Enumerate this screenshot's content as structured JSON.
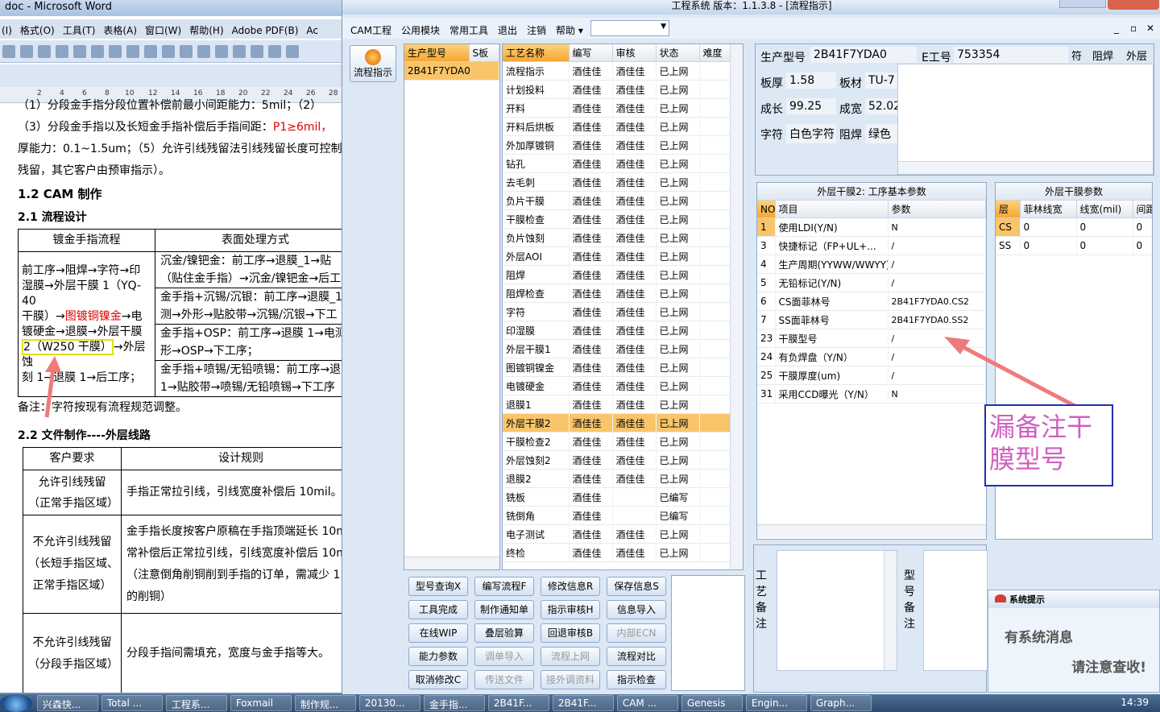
{
  "word": {
    "title": "doc - Microsoft Word",
    "menu": [
      "(I)",
      "格式(O)",
      "工具(T)",
      "表格(A)",
      "窗口(W)",
      "帮助(H)",
      "Adobe PDF(B)",
      "Ac"
    ],
    "ruler": [
      "2",
      "4",
      "6",
      "8",
      "10",
      "12",
      "14",
      "16",
      "18",
      "20",
      "22",
      "24",
      "26",
      "28"
    ],
    "lines": {
      "l1": "（1）分段金手指分段位置补偿前最小间距能力：5mil；（2）",
      "l2a": "（3）分段金手指以及长短金手指补偿后手指间距：",
      "l2b": "P1≥6mil，",
      "l3": "厚能力：0.1~1.5um；（5）允许引线残留法引线残留长度可控制在",
      "l4": "残留，其它客户由预审指示）。",
      "h12": "1.2 CAM 制作",
      "h21": "2.1 流程设计",
      "note": "备注：字符按现有流程规范调整。",
      "h22": "2.2 文件制作----外层线路"
    },
    "table1": {
      "head1": "镀金手指流程",
      "head2": "表面处理方式",
      "left": [
        "前工序→阻焊→字符→印",
        "湿膜→外层干膜 1（YQ-40",
        "干膜）→",
        "图镀铜镍金",
        "→电",
        "镀硬金→退膜→外层干膜",
        "2（W250 干膜）",
        "→外层蚀",
        "刻 1→退膜 1→后工序；"
      ],
      "r1": [
        "沉金/镍钯金：前工序→退膜_1→贴",
        "（贴住金手指）→沉金/镍钯金→后工"
      ],
      "r2": [
        "金手指+沉锡/沉银：前工序→退膜_1",
        "测→外形→贴胶带→沉锡/沉银→下工"
      ],
      "r3": [
        "金手指+OSP：前工序→退膜 1→电测",
        "形→OSP→下工序；"
      ],
      "r4": [
        "金手指+喷锡/无铅喷锡：前工序→退",
        "1→贴胶带→喷锡/无铅喷锡→下工序"
      ]
    },
    "table2": {
      "head1": "客户要求",
      "head2": "设计规则",
      "rows": [
        {
          "req": [
            "允许引线残留",
            "（正常手指区域）"
          ],
          "rule": [
            "手指正常拉引线，引线宽度补偿后 10mil。"
          ]
        },
        {
          "req": [
            "不允许引线残留",
            "（长短手指区域、",
            "正常手指区域）"
          ],
          "rule": [
            "金手指长度按客户原稿在手指顶端延长 10m",
            "常补偿后正常拉引线，引线宽度补偿后 10m",
            "（注意倒角削铜削到手指的订单，需减少 1",
            "的削铜）"
          ]
        },
        {
          "req": [
            "不允许引线残留",
            "（分段手指区域）"
          ],
          "rule": [
            "分段手指间需填充，宽度与金手指等大。"
          ]
        }
      ]
    }
  },
  "cam": {
    "title": "工程系统   版本：1.1.3.8 - [流程指示]",
    "menu": [
      "CAM工程",
      "公用模块",
      "常用工具",
      "退出",
      "注销",
      "帮助 ▾"
    ],
    "left_button": "流程指示",
    "model_list": {
      "col1": "生产型号",
      "col2": "S板",
      "row": "2B41F7YDA0"
    },
    "process": {
      "headers": [
        "工艺名称",
        "编写",
        "审核",
        "状态",
        "难度"
      ],
      "rows": [
        [
          "流程指示",
          "酒佳佳",
          "酒佳佳",
          "已上网"
        ],
        [
          "计划投料",
          "酒佳佳",
          "酒佳佳",
          "已上网"
        ],
        [
          "开料",
          "酒佳佳",
          "酒佳佳",
          "已上网"
        ],
        [
          "开料后烘板",
          "酒佳佳",
          "酒佳佳",
          "已上网"
        ],
        [
          "外加厚镀铜",
          "酒佳佳",
          "酒佳佳",
          "已上网"
        ],
        [
          "钻孔",
          "酒佳佳",
          "酒佳佳",
          "已上网"
        ],
        [
          "去毛刺",
          "酒佳佳",
          "酒佳佳",
          "已上网"
        ],
        [
          "负片干膜",
          "酒佳佳",
          "酒佳佳",
          "已上网"
        ],
        [
          "干膜检查",
          "酒佳佳",
          "酒佳佳",
          "已上网"
        ],
        [
          "负片蚀刻",
          "酒佳佳",
          "酒佳佳",
          "已上网"
        ],
        [
          "外层AOI",
          "酒佳佳",
          "酒佳佳",
          "已上网"
        ],
        [
          "阻焊",
          "酒佳佳",
          "酒佳佳",
          "已上网"
        ],
        [
          "阻焊检查",
          "酒佳佳",
          "酒佳佳",
          "已上网"
        ],
        [
          "字符",
          "酒佳佳",
          "酒佳佳",
          "已上网"
        ],
        [
          "印湿膜",
          "酒佳佳",
          "酒佳佳",
          "已上网"
        ],
        [
          "外层干膜1",
          "酒佳佳",
          "酒佳佳",
          "已上网"
        ],
        [
          "图镀铜镍金",
          "酒佳佳",
          "酒佳佳",
          "已上网"
        ],
        [
          "电镀硬金",
          "酒佳佳",
          "酒佳佳",
          "已上网"
        ],
        [
          "退膜1",
          "酒佳佳",
          "酒佳佳",
          "已上网"
        ],
        [
          "外层干膜2",
          "酒佳佳",
          "酒佳佳",
          "已上网"
        ],
        [
          "干膜检查2",
          "酒佳佳",
          "酒佳佳",
          "已上网"
        ],
        [
          "外层蚀刻2",
          "酒佳佳",
          "酒佳佳",
          "已上网"
        ],
        [
          "退膜2",
          "酒佳佳",
          "酒佳佳",
          "已上网"
        ],
        [
          "铣板",
          "酒佳佳",
          "",
          "已编写"
        ],
        [
          "铣倒角",
          "酒佳佳",
          "",
          "已编写"
        ],
        [
          "电子测试",
          "酒佳佳",
          "酒佳佳",
          "已上网"
        ],
        [
          "终检",
          "酒佳佳",
          "酒佳佳",
          "已上网"
        ]
      ],
      "selected_index": 19
    },
    "buttons": [
      [
        "型号查询X",
        "编写流程F",
        "修改信息R",
        "保存信息S"
      ],
      [
        "工具完成",
        "制作通知单",
        "指示审核H",
        "信息导入"
      ],
      [
        "在线WIP",
        "叠层验算",
        "回退审核B",
        "内部ECN"
      ],
      [
        "能力参数",
        "调单导入",
        "流程上网",
        "流程对比"
      ],
      [
        "取消修改C",
        "传送文件",
        "接外调资料",
        "指示检查"
      ]
    ],
    "disabled_buttons": [
      "内部ECN",
      "调单导入",
      "流程上网",
      "传送文件",
      "接外调资料"
    ],
    "info": {
      "model_label": "生产型号",
      "model_value": "2B41F7YDA0",
      "e_label": "E工号",
      "e_value": "753354",
      "c1": "符",
      "c2": "阻焊",
      "c3": "外层",
      "thick_label": "板厚",
      "thick_value": "1.58",
      "mat_label": "板材",
      "mat_value": "TU-7",
      "len_label": "成长",
      "len_value": "99.25",
      "wid_label": "成宽",
      "wid_value": "52.02",
      "char_label": "字符",
      "char_value": "白色字符",
      "mask_label": "阻焊",
      "mask_value": "绿色"
    },
    "params": {
      "title": "外层干膜2: 工序基本参数",
      "headers": [
        "NO",
        "项目",
        "参数"
      ],
      "rows": [
        [
          "1",
          "使用LDI(Y/N)",
          "N"
        ],
        [
          "3",
          "快捷标记（FP+UL+...",
          "/"
        ],
        [
          "4",
          "生产周期(YYWW/WWYY)",
          "/"
        ],
        [
          "5",
          "无铅标记(Y/N)",
          "/"
        ],
        [
          "6",
          "CS面菲林号",
          "2B41F7YDA0.CS2"
        ],
        [
          "7",
          "SS面菲林号",
          "2B41F7YDA0.SS2"
        ],
        [
          "23",
          "干膜型号",
          "/"
        ],
        [
          "24",
          "有负焊盘（Y/N）",
          "/"
        ],
        [
          "25",
          "干膜厚度(um)",
          "/"
        ],
        [
          "31",
          "采用CCD曝光（Y/N）",
          "N"
        ]
      ]
    },
    "outer_params": {
      "title": "外层干膜参数",
      "headers": [
        "层",
        "菲林线宽",
        "线宽(mil)",
        "间距"
      ],
      "rows": [
        [
          "CS",
          "0",
          "0",
          "0"
        ],
        [
          "SS",
          "0",
          "0",
          "0"
        ]
      ]
    },
    "process_note_label": "工艺备注",
    "model_note_label": "型号备注"
  },
  "annotation": "漏备注干膜型号",
  "notify": {
    "title": "系统提示",
    "line1": "有系统消息",
    "line2": "请注意查收!"
  },
  "taskbar": {
    "items": [
      "兴森快...",
      "Total ...",
      "工程系...",
      "Foxmail",
      "制作规...",
      "20130...",
      "金手指...",
      "2B41F...",
      "2B41F...",
      "CAM ...",
      "Genesis",
      "Engin...",
      "Graph..."
    ],
    "clock": "14:39"
  },
  "colors": {
    "selection": "#f9c56b",
    "annotation_border": "#2030b0",
    "annotation_text": "#d060c0",
    "arrow": "#f07a7a"
  }
}
